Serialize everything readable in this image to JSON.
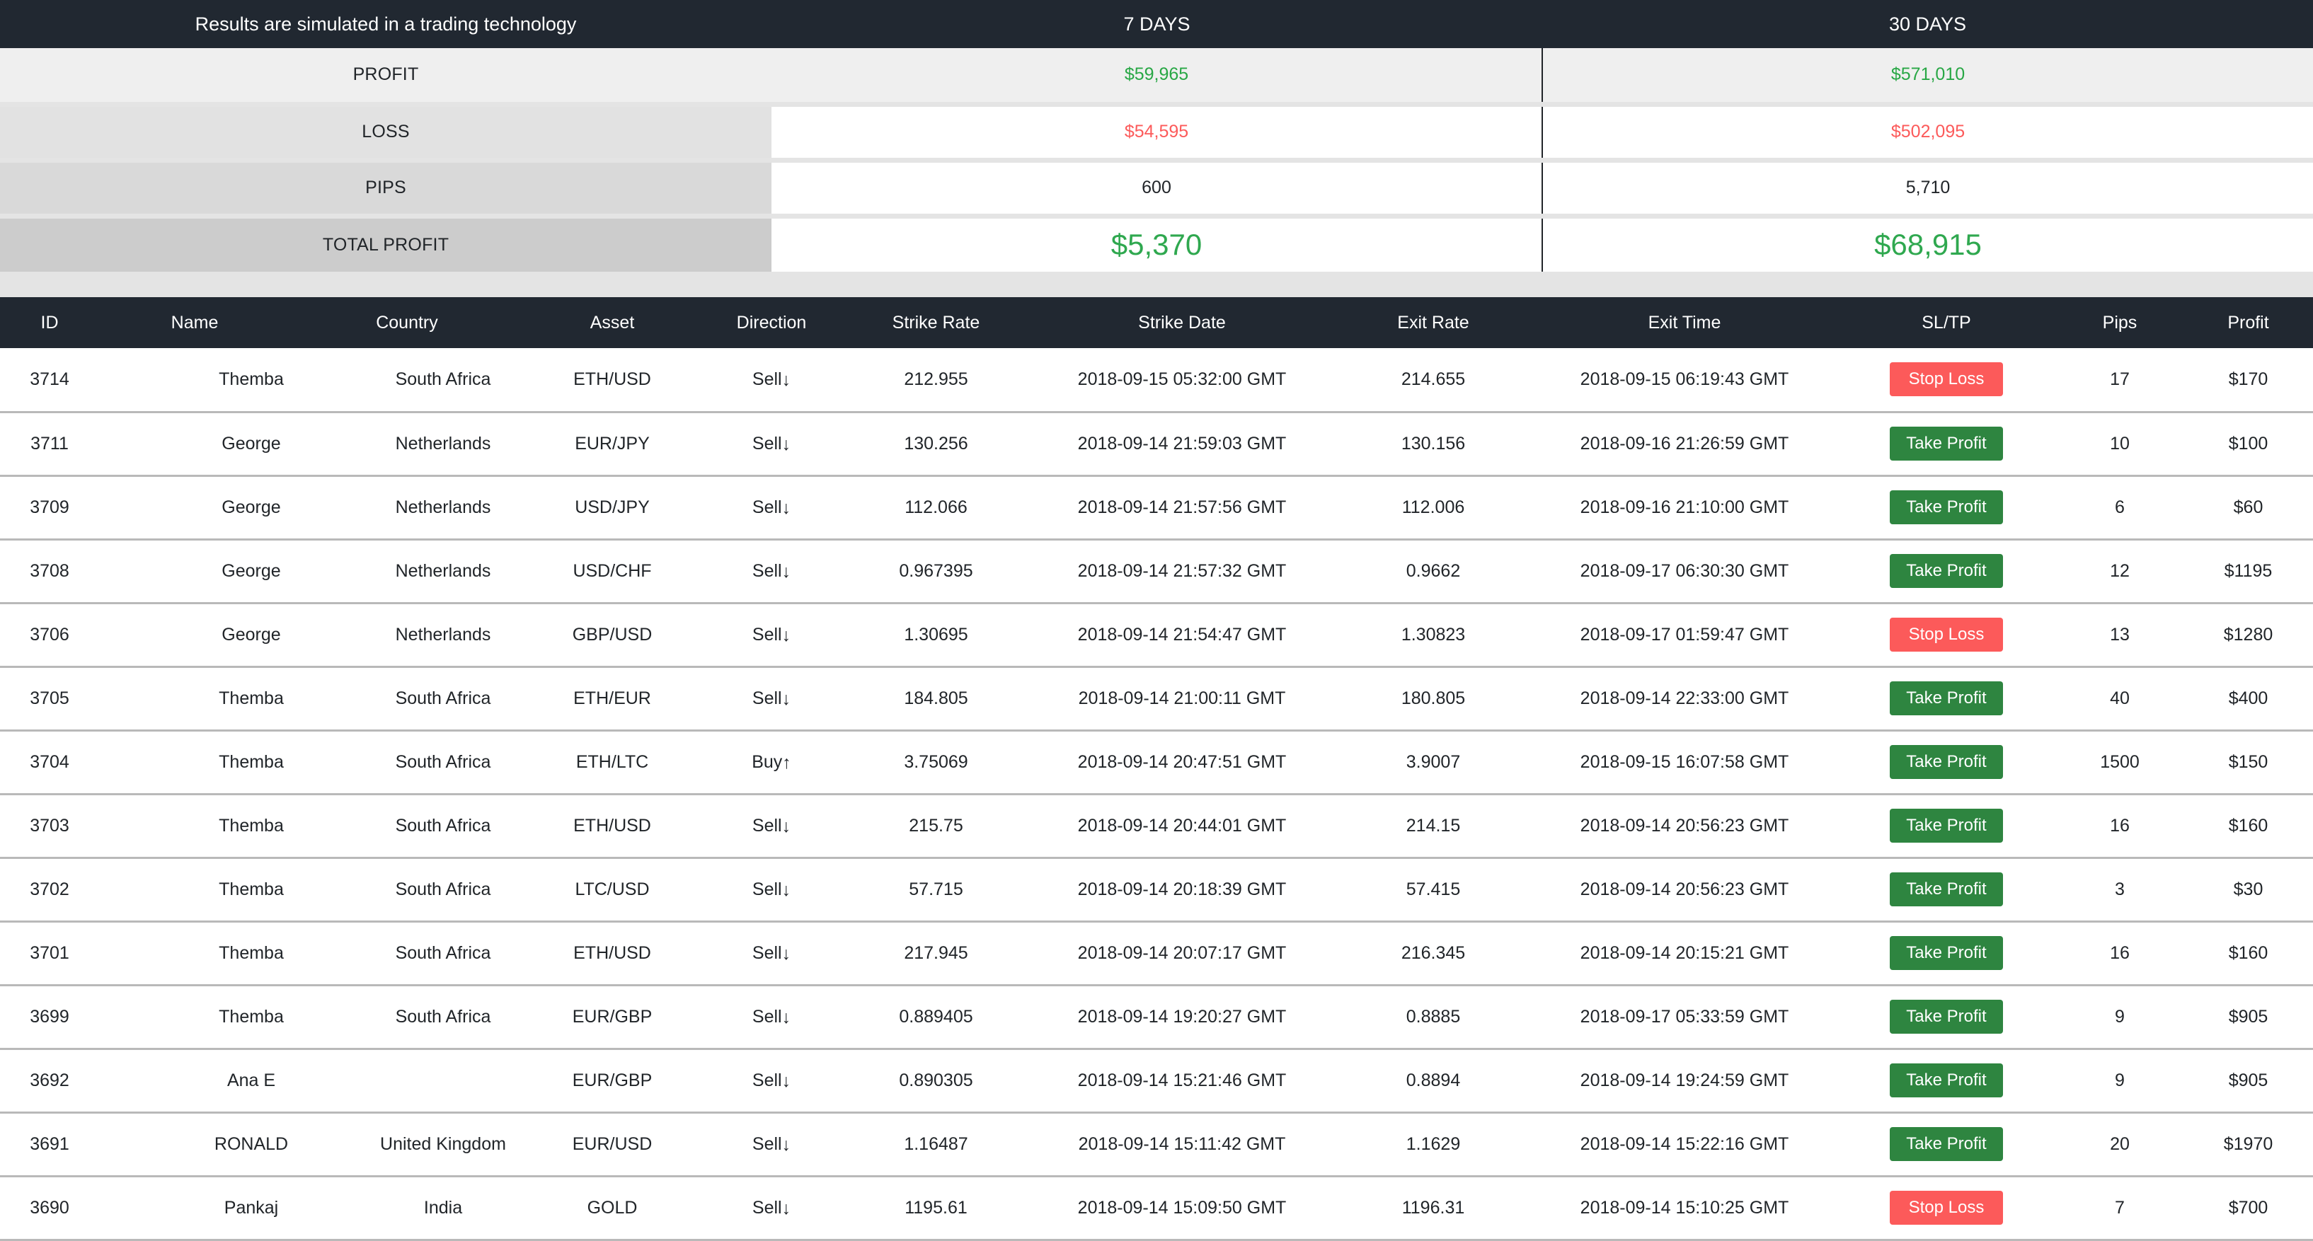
{
  "summary": {
    "disclaimer": "Results are simulated in a trading technology",
    "columns": [
      "7 DAYS",
      "30 DAYS"
    ],
    "rows": [
      {
        "label": "PROFIT",
        "d7": "$59,965",
        "d30": "$571,010",
        "style": "green"
      },
      {
        "label": "LOSS",
        "d7": "$54,595",
        "d30": "$502,095",
        "style": "red"
      },
      {
        "label": "PIPS",
        "d7": "600",
        "d30": "5,710",
        "style": "plain"
      },
      {
        "label": "TOTAL PROFIT",
        "d7": "$5,370",
        "d30": "$68,915",
        "style": "total"
      }
    ],
    "colors": {
      "green": "#28a745",
      "red": "#fc5a5a",
      "total_green": "#2fa84f",
      "header_bg": "#212831"
    }
  },
  "trades": {
    "headers": [
      "ID",
      "Name",
      "Country",
      "Asset",
      "Direction",
      "Strike Rate",
      "Strike Date",
      "Exit Rate",
      "Exit Time",
      "SL/TP",
      "Pips",
      "Profit"
    ],
    "badge_colors": {
      "stop_loss": "#fc5a5a",
      "take_profit": "#2e8540"
    },
    "rows": [
      {
        "id": "3714",
        "name": "Themba",
        "country": "South Africa",
        "asset": "ETH/USD",
        "direction": "Sell",
        "arrow": "↓",
        "strike_rate": "212.955",
        "strike_date": "2018-09-15 05:32:00 GMT",
        "exit_rate": "214.655",
        "exit_time": "2018-09-15 06:19:43 GMT",
        "sltp": "Stop Loss",
        "sltp_kind": "stoploss",
        "pips": "17",
        "profit": "$170"
      },
      {
        "id": "3711",
        "name": "George",
        "country": "Netherlands",
        "asset": "EUR/JPY",
        "direction": "Sell",
        "arrow": "↓",
        "strike_rate": "130.256",
        "strike_date": "2018-09-14 21:59:03 GMT",
        "exit_rate": "130.156",
        "exit_time": "2018-09-16 21:26:59 GMT",
        "sltp": "Take Profit",
        "sltp_kind": "takeprofit",
        "pips": "10",
        "profit": "$100"
      },
      {
        "id": "3709",
        "name": "George",
        "country": "Netherlands",
        "asset": "USD/JPY",
        "direction": "Sell",
        "arrow": "↓",
        "strike_rate": "112.066",
        "strike_date": "2018-09-14 21:57:56 GMT",
        "exit_rate": "112.006",
        "exit_time": "2018-09-16 21:10:00 GMT",
        "sltp": "Take Profit",
        "sltp_kind": "takeprofit",
        "pips": "6",
        "profit": "$60"
      },
      {
        "id": "3708",
        "name": "George",
        "country": "Netherlands",
        "asset": "USD/CHF",
        "direction": "Sell",
        "arrow": "↓",
        "strike_rate": "0.967395",
        "strike_date": "2018-09-14 21:57:32 GMT",
        "exit_rate": "0.9662",
        "exit_time": "2018-09-17 06:30:30 GMT",
        "sltp": "Take Profit",
        "sltp_kind": "takeprofit",
        "pips": "12",
        "profit": "$1195"
      },
      {
        "id": "3706",
        "name": "George",
        "country": "Netherlands",
        "asset": "GBP/USD",
        "direction": "Sell",
        "arrow": "↓",
        "strike_rate": "1.30695",
        "strike_date": "2018-09-14 21:54:47 GMT",
        "exit_rate": "1.30823",
        "exit_time": "2018-09-17 01:59:47 GMT",
        "sltp": "Stop Loss",
        "sltp_kind": "stoploss",
        "pips": "13",
        "profit": "$1280"
      },
      {
        "id": "3705",
        "name": "Themba",
        "country": "South Africa",
        "asset": "ETH/EUR",
        "direction": "Sell",
        "arrow": "↓",
        "strike_rate": "184.805",
        "strike_date": "2018-09-14 21:00:11 GMT",
        "exit_rate": "180.805",
        "exit_time": "2018-09-14 22:33:00 GMT",
        "sltp": "Take Profit",
        "sltp_kind": "takeprofit",
        "pips": "40",
        "profit": "$400"
      },
      {
        "id": "3704",
        "name": "Themba",
        "country": "South Africa",
        "asset": "ETH/LTC",
        "direction": "Buy",
        "arrow": "↑",
        "strike_rate": "3.75069",
        "strike_date": "2018-09-14 20:47:51 GMT",
        "exit_rate": "3.9007",
        "exit_time": "2018-09-15 16:07:58 GMT",
        "sltp": "Take Profit",
        "sltp_kind": "takeprofit",
        "pips": "1500",
        "profit": "$150"
      },
      {
        "id": "3703",
        "name": "Themba",
        "country": "South Africa",
        "asset": "ETH/USD",
        "direction": "Sell",
        "arrow": "↓",
        "strike_rate": "215.75",
        "strike_date": "2018-09-14 20:44:01 GMT",
        "exit_rate": "214.15",
        "exit_time": "2018-09-14 20:56:23 GMT",
        "sltp": "Take Profit",
        "sltp_kind": "takeprofit",
        "pips": "16",
        "profit": "$160"
      },
      {
        "id": "3702",
        "name": "Themba",
        "country": "South Africa",
        "asset": "LTC/USD",
        "direction": "Sell",
        "arrow": "↓",
        "strike_rate": "57.715",
        "strike_date": "2018-09-14 20:18:39 GMT",
        "exit_rate": "57.415",
        "exit_time": "2018-09-14 20:56:23 GMT",
        "sltp": "Take Profit",
        "sltp_kind": "takeprofit",
        "pips": "3",
        "profit": "$30"
      },
      {
        "id": "3701",
        "name": "Themba",
        "country": "South Africa",
        "asset": "ETH/USD",
        "direction": "Sell",
        "arrow": "↓",
        "strike_rate": "217.945",
        "strike_date": "2018-09-14 20:07:17 GMT",
        "exit_rate": "216.345",
        "exit_time": "2018-09-14 20:15:21 GMT",
        "sltp": "Take Profit",
        "sltp_kind": "takeprofit",
        "pips": "16",
        "profit": "$160"
      },
      {
        "id": "3699",
        "name": "Themba",
        "country": "South Africa",
        "asset": "EUR/GBP",
        "direction": "Sell",
        "arrow": "↓",
        "strike_rate": "0.889405",
        "strike_date": "2018-09-14 19:20:27 GMT",
        "exit_rate": "0.8885",
        "exit_time": "2018-09-17 05:33:59 GMT",
        "sltp": "Take Profit",
        "sltp_kind": "takeprofit",
        "pips": "9",
        "profit": "$905"
      },
      {
        "id": "3692",
        "name": "Ana E",
        "country": "",
        "asset": "EUR/GBP",
        "direction": "Sell",
        "arrow": "↓",
        "strike_rate": "0.890305",
        "strike_date": "2018-09-14 15:21:46 GMT",
        "exit_rate": "0.8894",
        "exit_time": "2018-09-14 19:24:59 GMT",
        "sltp": "Take Profit",
        "sltp_kind": "takeprofit",
        "pips": "9",
        "profit": "$905"
      },
      {
        "id": "3691",
        "name": "RONALD",
        "country": "United Kingdom",
        "asset": "EUR/USD",
        "direction": "Sell",
        "arrow": "↓",
        "strike_rate": "1.16487",
        "strike_date": "2018-09-14 15:11:42 GMT",
        "exit_rate": "1.1629",
        "exit_time": "2018-09-14 15:22:16 GMT",
        "sltp": "Take Profit",
        "sltp_kind": "takeprofit",
        "pips": "20",
        "profit": "$1970"
      },
      {
        "id": "3690",
        "name": "Pankaj",
        "country": "India",
        "asset": "GOLD",
        "direction": "Sell",
        "arrow": "↓",
        "strike_rate": "1195.61",
        "strike_date": "2018-09-14 15:09:50 GMT",
        "exit_rate": "1196.31",
        "exit_time": "2018-09-14 15:10:25 GMT",
        "sltp": "Stop Loss",
        "sltp_kind": "stoploss",
        "pips": "7",
        "profit": "$700"
      }
    ]
  }
}
